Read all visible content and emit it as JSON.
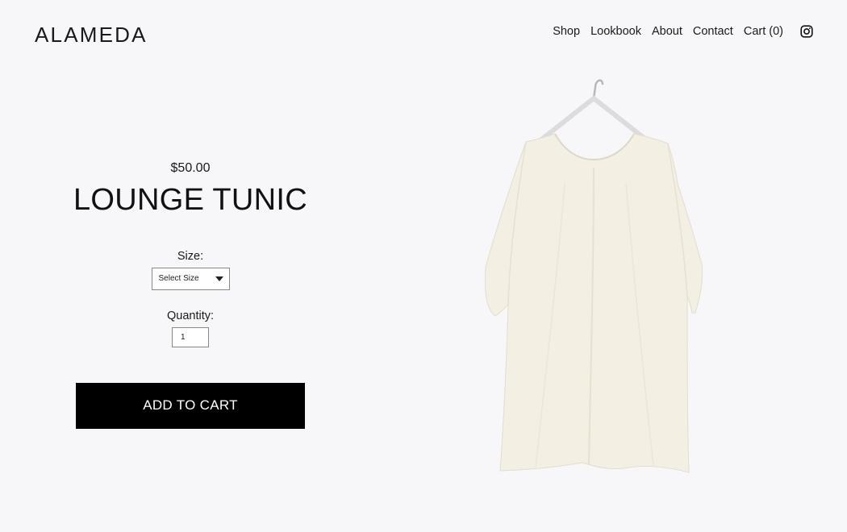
{
  "header": {
    "brand": "ALAMEDA",
    "nav": [
      "Shop",
      "Lookbook",
      "About",
      "Contact",
      "Cart (0)"
    ],
    "social_icon": "instagram-icon"
  },
  "product": {
    "price": "$50.00",
    "title": "LOUNGE TUNIC",
    "size_label": "Size:",
    "size_selected": "Select Size",
    "quantity_label": "Quantity:",
    "quantity_value": "1",
    "add_to_cart": "ADD TO CART",
    "image_color": "#f3efe2"
  },
  "colors": {
    "background": "#f7f6f9",
    "button_bg": "#000000",
    "button_text": "#ffffff"
  }
}
